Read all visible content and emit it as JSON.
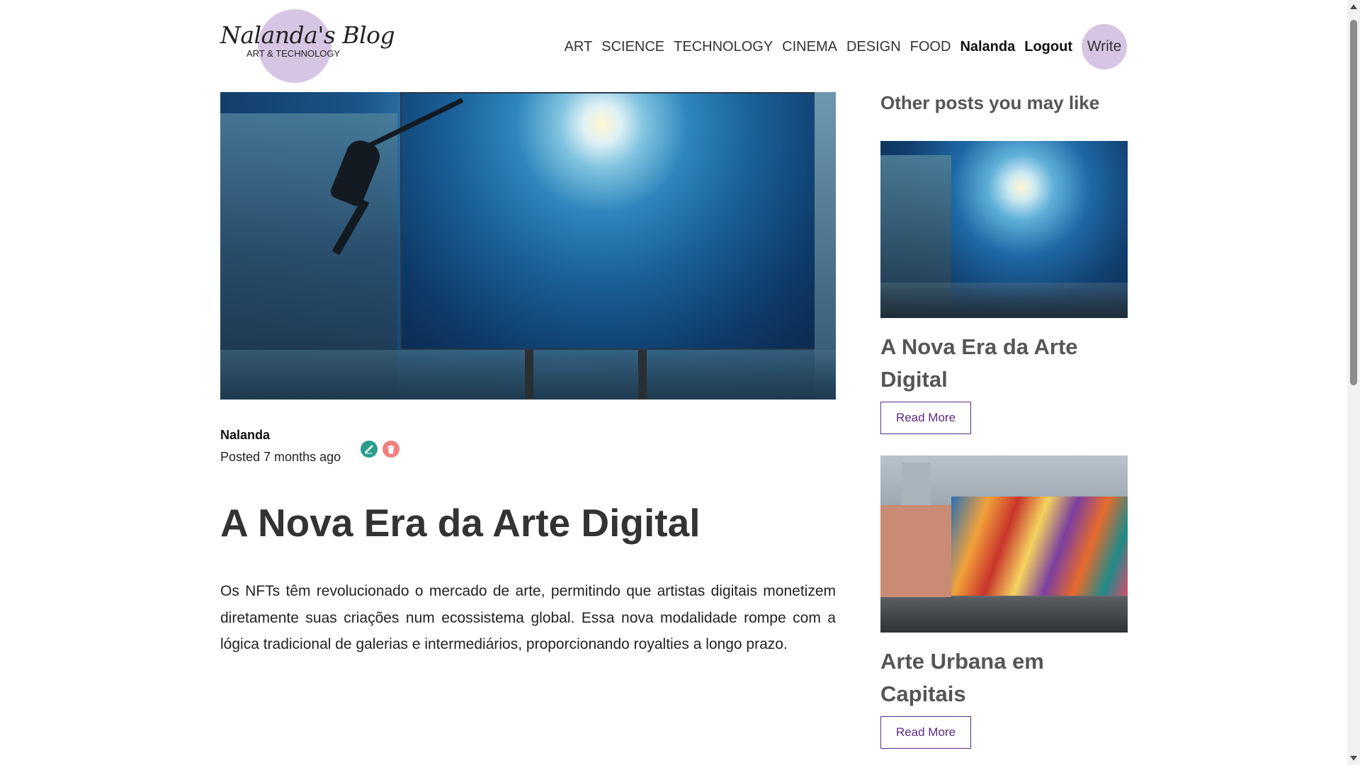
{
  "brand": {
    "title": "Nalanda's Blog",
    "subtitle": "ART & TECHNOLOGY",
    "accent_color": "#d6c6e4"
  },
  "nav": {
    "items": [
      "ART",
      "SCIENCE",
      "TECHNOLOGY",
      "CINEMA",
      "DESIGN",
      "FOOD"
    ],
    "username": "Nalanda",
    "logout": "Logout",
    "write": "Write"
  },
  "post": {
    "author": "Nalanda",
    "posted": "Posted 7 months ago",
    "title": "A Nova Era da Arte Digital",
    "body": "Os NFTs têm revolucionado o mercado de arte, permitindo que artistas digitais monetizem diretamente suas criações num ecossistema global. Essa nova modalidade rompe com a lógica tradicional de galerias e intermediários, proporcionando royalties a longo prazo.",
    "edit_icon": "pencil-icon",
    "delete_icon": "trash-icon",
    "edit_color": "#2a9d8f",
    "delete_color": "#f08080"
  },
  "sidebar": {
    "heading": "Other posts you may like",
    "posts": [
      {
        "title": "A Nova Era da Arte Digital",
        "button": "Read More"
      },
      {
        "title": "Arte Urbana em Capitais",
        "button": "Read More"
      }
    ],
    "button_color": "#5b2a86"
  }
}
